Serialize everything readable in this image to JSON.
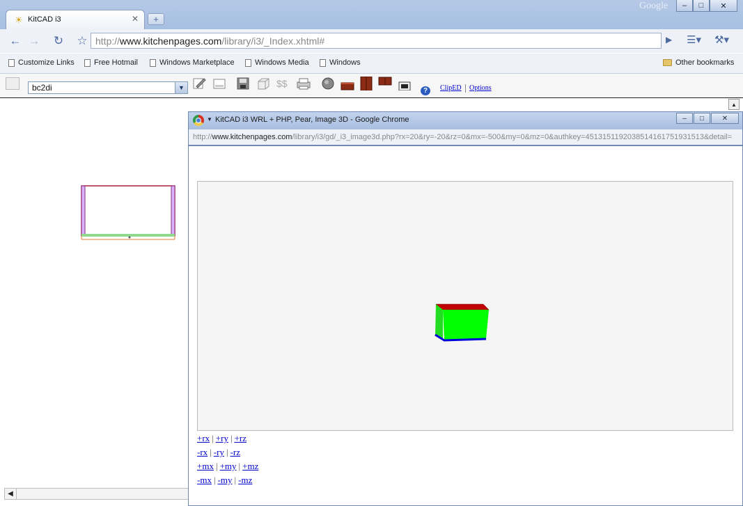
{
  "browser": {
    "brand": "Google",
    "tab": {
      "title": "KitCAD i3"
    },
    "omnibox": {
      "prefix": "http://",
      "host": "www.kitchenpages.com",
      "path": "/library/i3/_Index.xhtml#"
    },
    "bookmarks": [
      {
        "label": "Customize Links"
      },
      {
        "label": "Free Hotmail"
      },
      {
        "label": "Windows Marketplace"
      },
      {
        "label": "Windows Media"
      },
      {
        "label": "Windows"
      }
    ],
    "other_bookmarks": "Other bookmarks"
  },
  "app": {
    "profile_select": {
      "value": "bc2di"
    },
    "links": {
      "clipbed": "ClipED",
      "options": "Options"
    }
  },
  "popup": {
    "title": "KitCAD i3 WRL + PHP, Pear, Image 3D - Google Chrome",
    "url": {
      "prefix": "http://",
      "host": "www.kitchenpages.com",
      "path": "/library/i3/gd/_i3_image3d.php?rx=20&ry=-20&rz=0&mx=-500&my=0&mz=0&authkey=4513151192038514161751931513&detail="
    },
    "controls": [
      [
        "+rx",
        "+ry",
        "+rz"
      ],
      [
        "-rx",
        "-ry",
        "-rz"
      ],
      [
        "+mx",
        "+my",
        "+mz"
      ],
      [
        "-mx",
        "-my",
        "-mz"
      ]
    ]
  },
  "colors": {
    "cube_top": "#c00000",
    "cube_front": "#00ff00",
    "cube_bottom_edge": "#0000dd",
    "link": "#0000cc"
  }
}
